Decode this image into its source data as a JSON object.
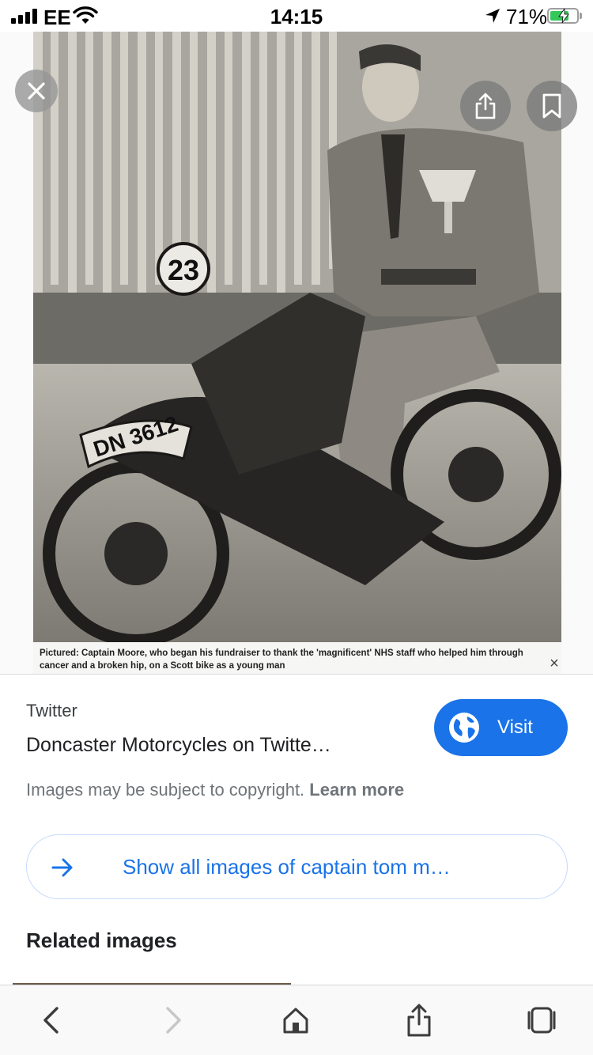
{
  "status_bar": {
    "carrier": "EE",
    "time": "14:15",
    "battery_percent": "71%",
    "battery_level": 0.71
  },
  "image_viewer": {
    "caption": "Pictured: Captain Moore, who began his fundraiser to thank the 'magnificent' NHS staff who helped him through cancer and a broken hip, on a Scott bike as a young man",
    "caption_close": "×",
    "photo_number_plate": "23",
    "photo_registration": "DN 3612"
  },
  "result": {
    "source": "Twitter",
    "title": "Doncaster Motorcycles on Twitte…",
    "visit_label": "Visit",
    "copyright_text": "Images may be subject to copyright.",
    "learn_more": "Learn more",
    "show_all_label": "Show all images of captain tom m…",
    "related_heading": "Related images"
  },
  "colors": {
    "accent": "#1a73e8",
    "battery_green": "#34c759"
  },
  "icons": {
    "close": "close-icon",
    "share": "share-icon",
    "bookmark": "bookmark-icon",
    "globe": "globe-icon",
    "arrow": "arrow-right-icon",
    "back": "chevron-left-icon",
    "forward": "chevron-right-icon",
    "home": "home-icon",
    "tabs": "tabs-icon"
  }
}
